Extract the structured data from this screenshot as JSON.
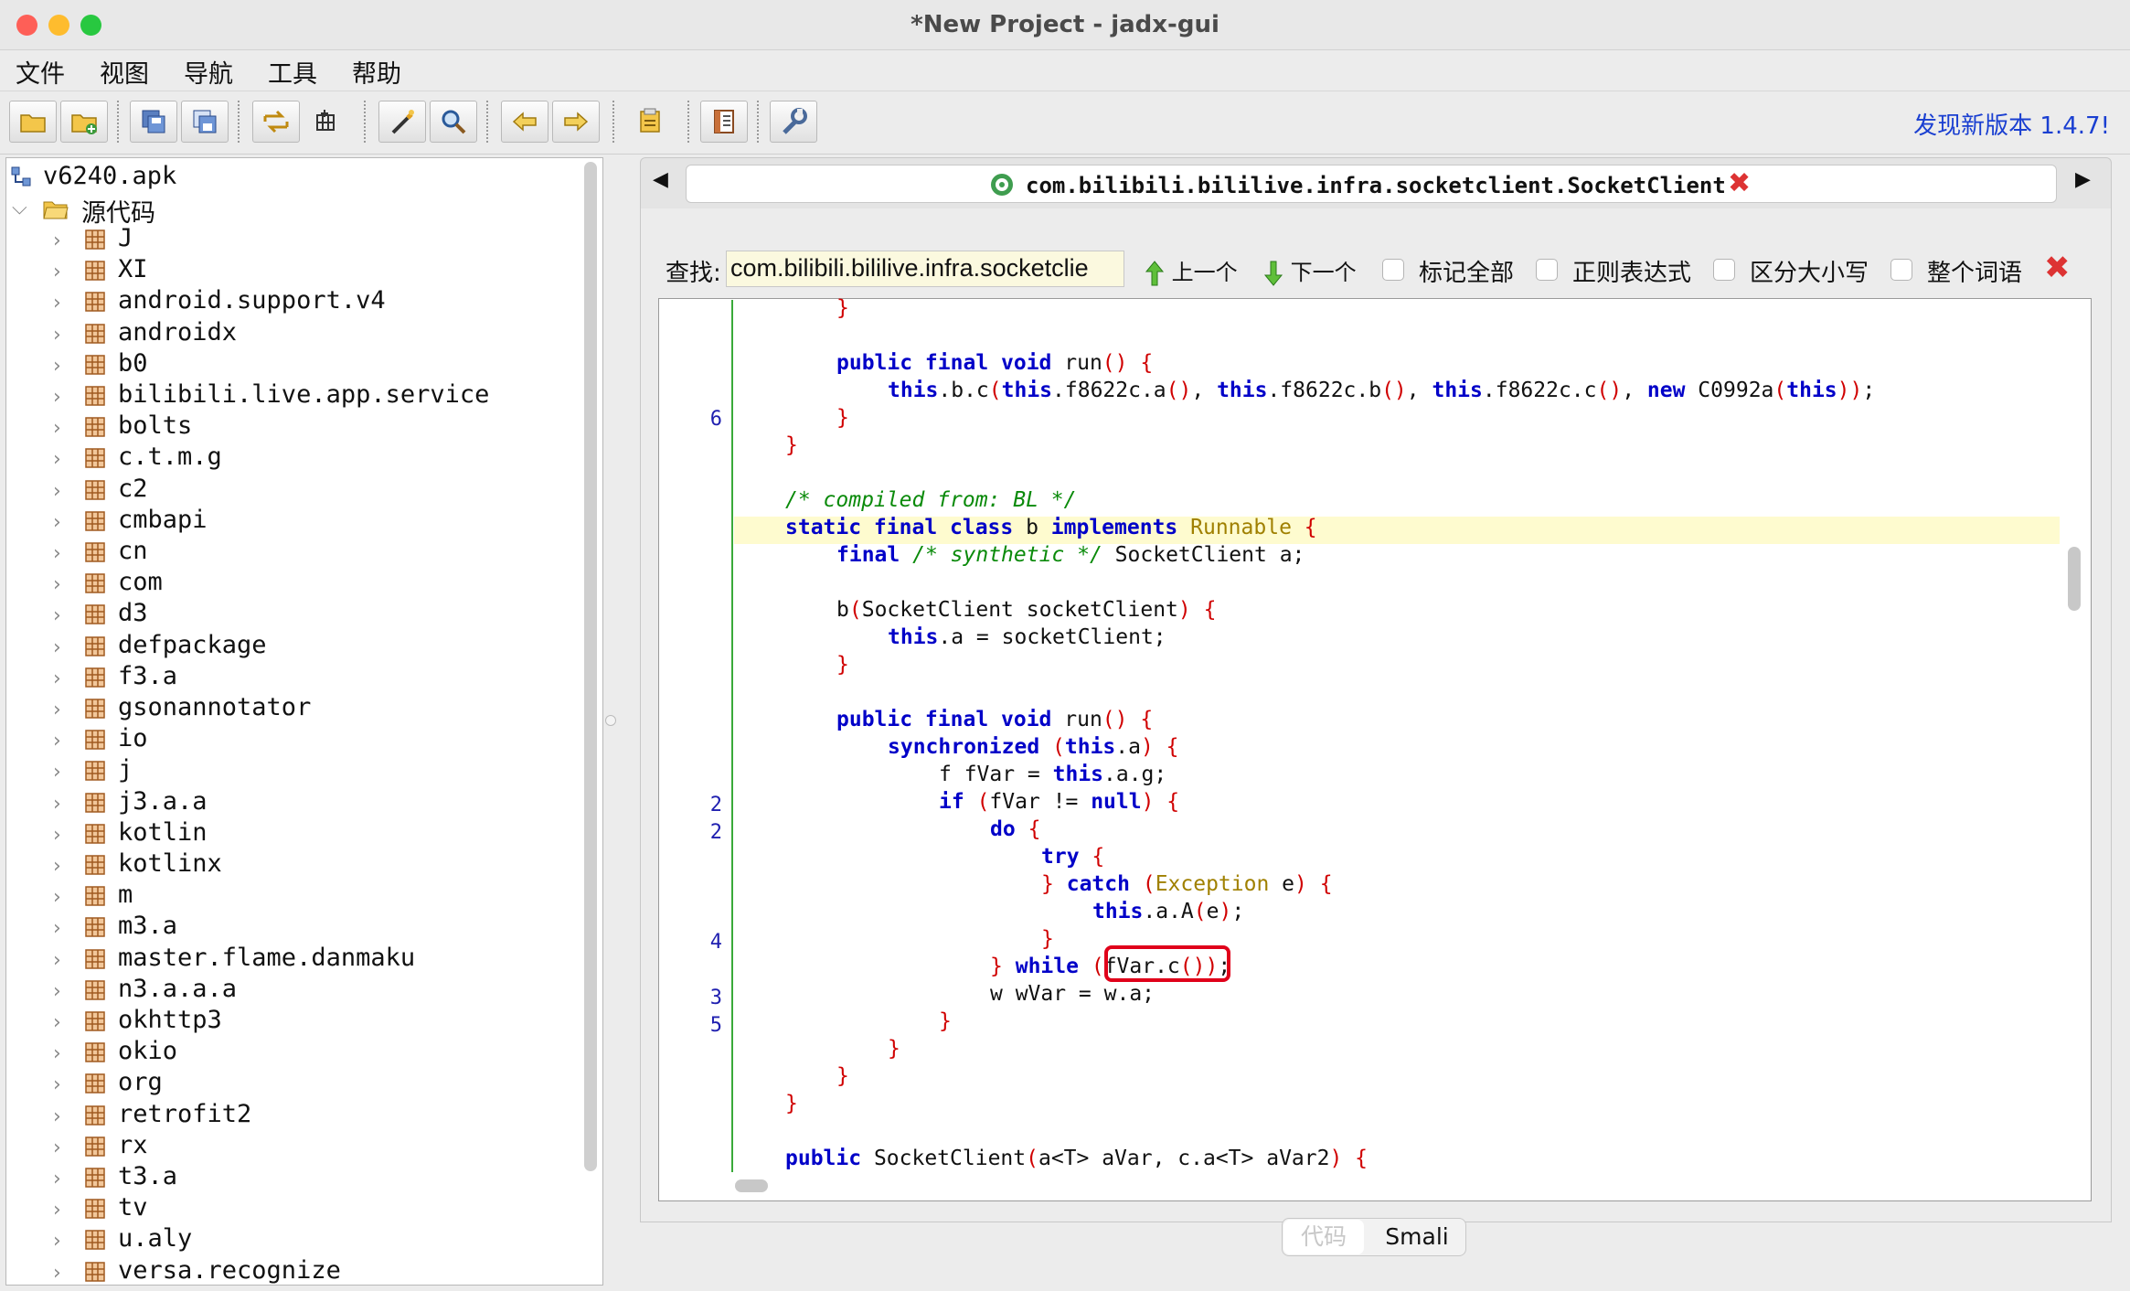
{
  "window": {
    "title": "*New Project - jadx-gui",
    "lights": {
      "close": "#fe5f57",
      "minimize": "#febc2e",
      "zoom": "#28c840"
    }
  },
  "menu": [
    "文件",
    "视图",
    "导航",
    "工具",
    "帮助"
  ],
  "toolbar": {
    "icons": [
      "open-file-icon",
      "add-files-icon",
      "save-all-icon",
      "export-icon",
      "sync-icon",
      "flatten-packages-icon",
      "decompile-icon",
      "search-icon",
      "back-icon",
      "forward-icon",
      "log-icon",
      "deobfuscation-icon",
      "preferences-icon"
    ],
    "new_version": "发现新版本 1.4.7!"
  },
  "tree": {
    "root": "v6240.apk",
    "source_folder": "源代码",
    "packages": [
      "J",
      "XI",
      "android.support.v4",
      "androidx",
      "b0",
      "bilibili.live.app.service",
      "bolts",
      "c.t.m.g",
      "c2",
      "cmbapi",
      "cn",
      "com",
      "d3",
      "defpackage",
      "f3.a",
      "gsonannotator",
      "io",
      "j",
      "j3.a.a",
      "kotlin",
      "kotlinx",
      "m",
      "m3.a",
      "master.flame.danmaku",
      "n3.a.a.a",
      "okhttp3",
      "okio",
      "org",
      "retrofit2",
      "rx",
      "t3.a",
      "tv",
      "u.aly",
      "versa.recognize"
    ]
  },
  "tab": {
    "label": "com.bilibili.bililive.infra.socketclient.SocketClient",
    "prev": "◀",
    "next": "▶"
  },
  "search": {
    "label": "查找:",
    "value": "com.bilibili.bililive.infra.socketclie",
    "prev_label": "上一个",
    "next_label": "下一个",
    "options": [
      "标记全部",
      "正则表达式",
      "区分大小写",
      "整个词语"
    ]
  },
  "code": {
    "line_numbers": [
      {
        "line": 4,
        "num": "6"
      },
      {
        "line": 18,
        "num": "2"
      },
      {
        "line": 19,
        "num": "2"
      },
      {
        "line": 23,
        "num": "4"
      },
      {
        "line": 25,
        "num": "3"
      },
      {
        "line": 26,
        "num": "5"
      }
    ]
  },
  "view_toggle": {
    "code": "代码",
    "smali": "Smali"
  },
  "colors": {
    "keyword": "#0000c8",
    "brace": "#d00000",
    "comment": "#0a8a0a",
    "type": "#a08000",
    "link": "#1a3fd1",
    "match_box": "#e0001a"
  }
}
